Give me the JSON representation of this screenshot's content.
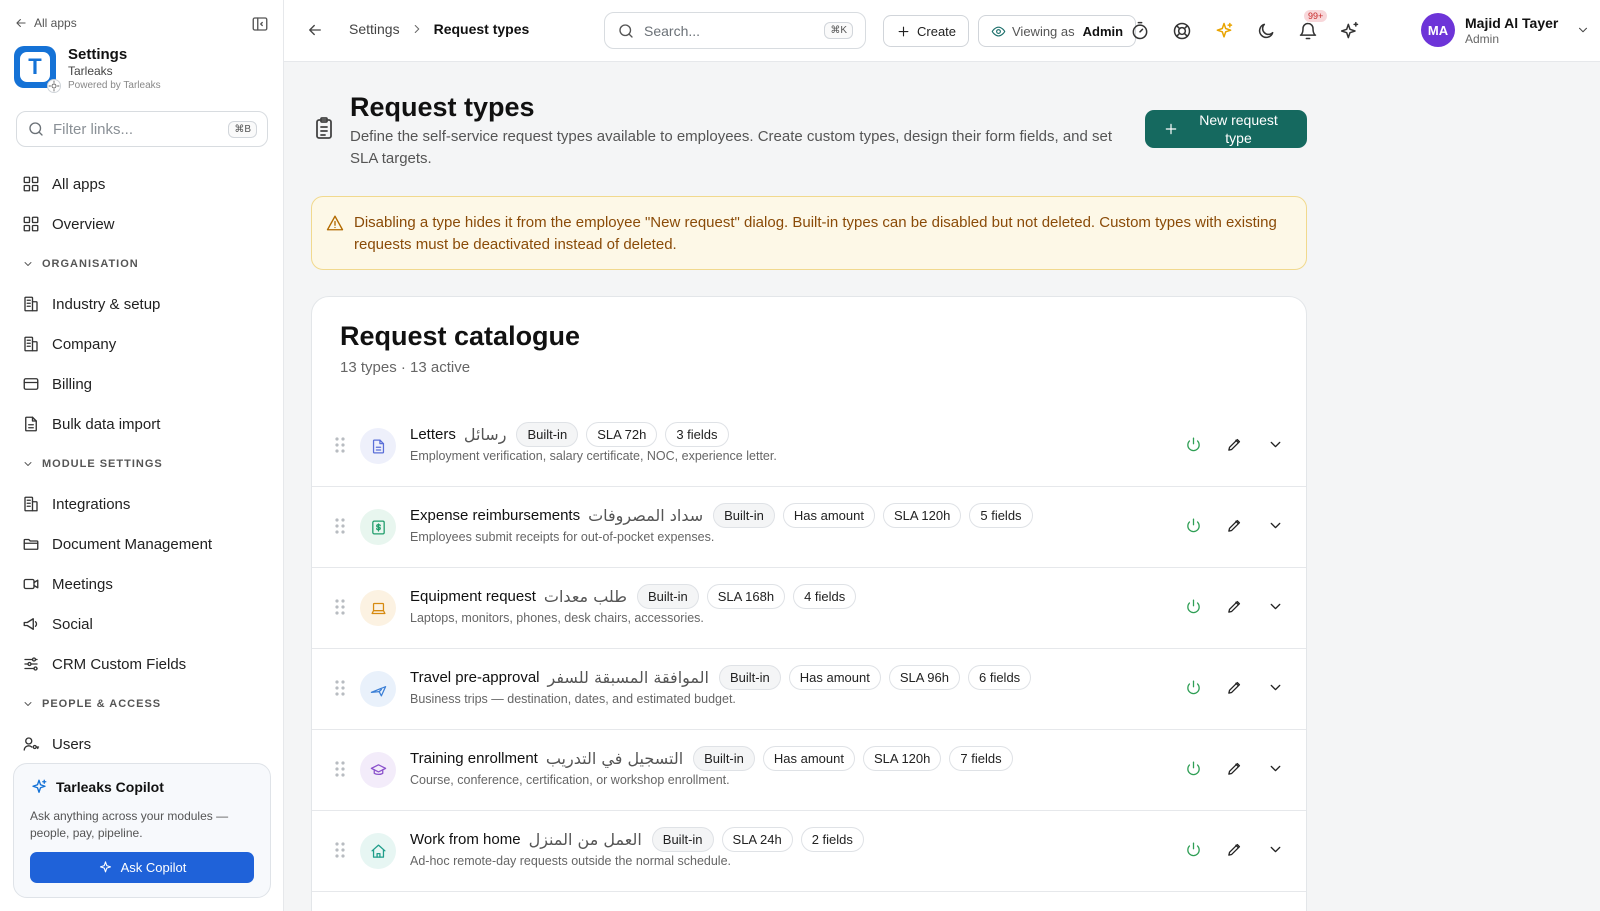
{
  "sidebar": {
    "back_label": "All apps",
    "app_title": "Settings",
    "org_name": "Tarleaks",
    "powered": "Powered by Tarleaks",
    "logo_letter": "T",
    "filter_placeholder": "Filter links...",
    "filter_shortcut": "⌘B",
    "items_top": [
      {
        "label": "All apps",
        "icon": "grid-icon"
      },
      {
        "label": "Overview",
        "icon": "grid-icon"
      }
    ],
    "sections": [
      {
        "title": "ORGANISATION",
        "items": [
          {
            "label": "Industry & setup",
            "icon": "building-icon"
          },
          {
            "label": "Company",
            "icon": "building-icon"
          },
          {
            "label": "Billing",
            "icon": "card-icon"
          },
          {
            "label": "Bulk data import",
            "icon": "file-icon"
          }
        ]
      },
      {
        "title": "MODULE SETTINGS",
        "items": [
          {
            "label": "Integrations",
            "icon": "building-icon"
          },
          {
            "label": "Document Management",
            "icon": "folder-icon"
          },
          {
            "label": "Meetings",
            "icon": "video-icon"
          },
          {
            "label": "Social",
            "icon": "megaphone-icon"
          },
          {
            "label": "CRM Custom Fields",
            "icon": "sliders-icon"
          }
        ]
      },
      {
        "title": "PEOPLE & ACCESS",
        "items": [
          {
            "label": "Users",
            "icon": "user-key-icon"
          }
        ]
      }
    ],
    "copilot": {
      "title": "Tarleaks Copilot",
      "description": "Ask anything across your modules — people, pay, pipeline.",
      "button": "Ask Copilot"
    }
  },
  "header": {
    "breadcrumb_parent": "Settings",
    "breadcrumb_current": "Request types",
    "search_placeholder": "Search...",
    "search_shortcut": "⌘K",
    "create_label": "Create",
    "viewing_label": "Viewing as",
    "viewing_role": "Admin",
    "notifications_count": "99+",
    "user": {
      "initials": "MA",
      "name": "Majid Al Tayer",
      "role": "Admin"
    }
  },
  "page": {
    "title": "Request types",
    "description": "Define the self-service request types available to employees. Create custom types, design their form fields, and set SLA targets.",
    "new_button": "New request type",
    "alert": "Disabling a type hides it from the employee \"New request\" dialog. Built-in types can be disabled but not deleted. Custom types with existing requests must be deactivated instead of deleted."
  },
  "catalogue": {
    "title": "Request catalogue",
    "summary": "13 types · 13 active",
    "rows": [
      {
        "name": "Letters",
        "arabic": "رسائل",
        "tags": [
          "Built-in",
          "SLA 72h",
          "3 fields"
        ],
        "description": "Employment verification, salary certificate, NOC, experience letter.",
        "icon": "document-icon",
        "color": "#5b6fd8",
        "bg": "#eef0fb"
      },
      {
        "name": "Expense reimbursements",
        "arabic": "سداد المصروفات",
        "tags": [
          "Built-in",
          "Has amount",
          "SLA 120h",
          "5 fields"
        ],
        "description": "Employees submit receipts for out-of-pocket expenses.",
        "icon": "receipt-icon",
        "color": "#1f9d6b",
        "bg": "#e8f6ef"
      },
      {
        "name": "Equipment request",
        "arabic": "طلب معدات",
        "tags": [
          "Built-in",
          "SLA 168h",
          "4 fields"
        ],
        "description": "Laptops, monitors, phones, desk chairs, accessories.",
        "icon": "laptop-icon",
        "color": "#d68a10",
        "bg": "#fcf2e2"
      },
      {
        "name": "Travel pre-approval",
        "arabic": "الموافقة المسبقة للسفر",
        "tags": [
          "Built-in",
          "Has amount",
          "SLA 96h",
          "6 fields"
        ],
        "description": "Business trips — destination, dates, and estimated budget.",
        "icon": "plane-icon",
        "color": "#3b7fd6",
        "bg": "#e9f1fb"
      },
      {
        "name": "Training enrollment",
        "arabic": "التسجيل في التدريب",
        "tags": [
          "Built-in",
          "Has amount",
          "SLA 120h",
          "7 fields"
        ],
        "description": "Course, conference, certification, or workshop enrollment.",
        "icon": "graduation-cap-icon",
        "color": "#8b52cc",
        "bg": "#f3ecfa"
      },
      {
        "name": "Work from home",
        "arabic": "العمل من المنزل",
        "tags": [
          "Built-in",
          "SLA 24h",
          "2 fields"
        ],
        "description": "Ad-hoc remote-day requests outside the normal schedule.",
        "icon": "home-icon",
        "color": "#1f9d8a",
        "bg": "#e7f6f3"
      }
    ]
  }
}
